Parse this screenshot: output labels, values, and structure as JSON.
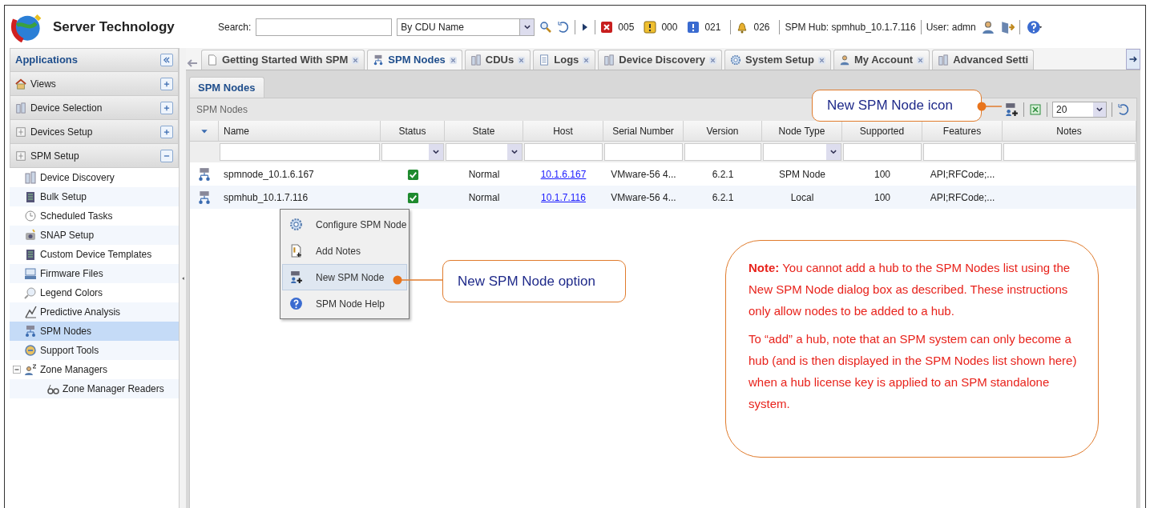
{
  "app": {
    "title": "Server Technology"
  },
  "toolbar": {
    "search_label": "Search:",
    "search_by": "By CDU Name",
    "counts": [
      {
        "kind": "critical",
        "count": "005"
      },
      {
        "kind": "warning",
        "count": "000"
      },
      {
        "kind": "info",
        "count": "021"
      },
      {
        "kind": "alarm",
        "count": "026"
      }
    ],
    "hub": "SPM Hub: spmhub_10.1.7.116",
    "user": "User: admn"
  },
  "sidebar": {
    "title": "Applications",
    "sections": [
      {
        "label": "Views",
        "expanded": false
      },
      {
        "label": "Device Selection",
        "expanded": false
      },
      {
        "label": "Devices Setup",
        "expanded": false
      },
      {
        "label": "SPM Setup",
        "expanded": true,
        "items": [
          {
            "label": "Device Discovery",
            "selected": false
          },
          {
            "label": "Bulk Setup",
            "selected": false
          },
          {
            "label": "Scheduled Tasks",
            "selected": false
          },
          {
            "label": "SNAP Setup",
            "selected": false
          },
          {
            "label": "Custom Device Templates",
            "selected": false
          },
          {
            "label": "Firmware Files",
            "selected": false
          },
          {
            "label": "Legend Colors",
            "selected": false
          },
          {
            "label": "Predictive Analysis",
            "selected": false
          },
          {
            "label": "SPM Nodes",
            "selected": true
          },
          {
            "label": "Support Tools",
            "selected": false
          },
          {
            "label": "Zone Managers",
            "selected": false,
            "expanded": true,
            "children": [
              {
                "label": "Zone Manager Readers",
                "selected": false
              }
            ]
          }
        ]
      }
    ]
  },
  "tabs": [
    {
      "label": "Getting Started With SPM",
      "selected": false
    },
    {
      "label": "SPM Nodes",
      "selected": true
    },
    {
      "label": "CDUs",
      "selected": false
    },
    {
      "label": "Logs",
      "selected": false
    },
    {
      "label": "Device Discovery",
      "selected": false
    },
    {
      "label": "System Setup",
      "selected": false
    },
    {
      "label": "My Account",
      "selected": false
    },
    {
      "label": "Advanced Setti",
      "selected": false
    }
  ],
  "subtabs": [
    {
      "label": "SPM Nodes",
      "selected": true
    }
  ],
  "panel": {
    "title": "SPM Nodes",
    "page_size": "20"
  },
  "table": {
    "columns": [
      {
        "label": "Name",
        "dropdown": false
      },
      {
        "label": "Status",
        "dropdown": true
      },
      {
        "label": "State",
        "dropdown": true
      },
      {
        "label": "Host",
        "dropdown": false
      },
      {
        "label": "Serial Number",
        "dropdown": false
      },
      {
        "label": "Version",
        "dropdown": false
      },
      {
        "label": "Node Type",
        "dropdown": true
      },
      {
        "label": "Supported",
        "dropdown": false
      },
      {
        "label": "Features",
        "dropdown": false
      },
      {
        "label": "Notes",
        "dropdown": false
      }
    ],
    "rows": [
      {
        "name": "spmnode_10.1.6.167",
        "status_ok": true,
        "state": "Normal",
        "host": "10.1.6.167",
        "serial": "VMware-56 4...",
        "version": "6.2.1",
        "node_type": "SPM Node",
        "supported": "100",
        "features": "API;RFCode;..."
      },
      {
        "name": "spmhub_10.1.7.116",
        "status_ok": true,
        "state": "Normal",
        "host": "10.1.7.116",
        "serial": "VMware-56 4...",
        "version": "6.2.1",
        "node_type": "Local",
        "supported": "100",
        "features": "API;RFCode;..."
      }
    ]
  },
  "context_menu": [
    {
      "label": "Configure SPM Node",
      "selected": false
    },
    {
      "label": "Add Notes",
      "selected": false
    },
    {
      "label": "New SPM Node",
      "selected": true
    },
    {
      "label": "SPM Node Help",
      "selected": false
    }
  ],
  "callouts": [
    {
      "text": "New SPM Node icon"
    },
    {
      "text": "New SPM Node option"
    }
  ],
  "note": {
    "paragraphs": [
      "**Note:** You cannot add a hub to the SPM Nodes list using the New SPM Node dialog box as described. These instructions only allow nodes to be added to a hub.",
      "To “add” a hub, note that an SPM system can only become a hub (and is then displayed in the SPM Nodes list shown here) when a hub license key is applied to an SPM standalone system."
    ]
  }
}
